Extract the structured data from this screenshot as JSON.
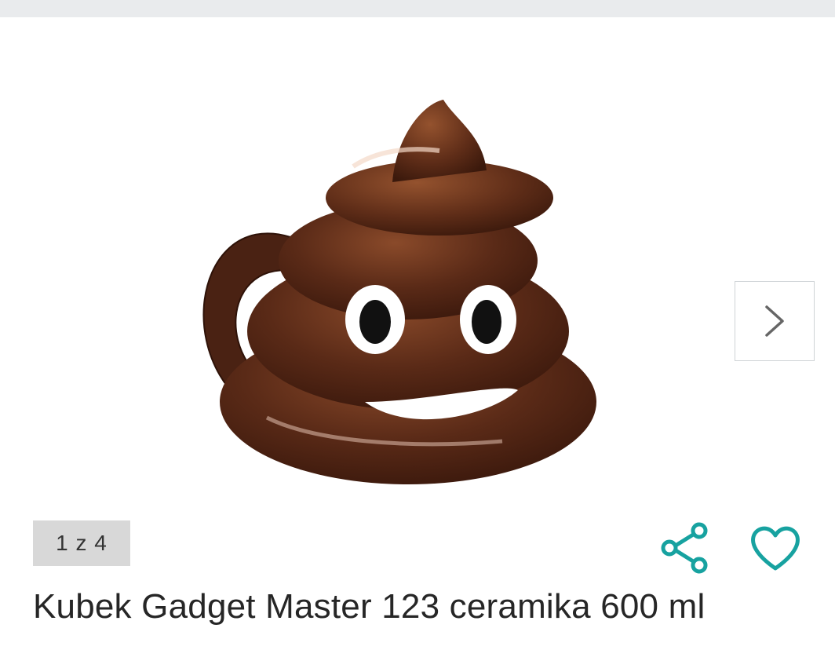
{
  "gallery": {
    "counter": "1 z 4",
    "image_icon": "poop-emoji-mug-image",
    "next_icon": "chevron-right-icon"
  },
  "actions": {
    "share_icon": "share-icon",
    "favorite_icon": "heart-icon",
    "accent_color": "#17a2a0"
  },
  "product": {
    "title": "Kubek Gadget Master 123 ceramika 600 ml"
  }
}
